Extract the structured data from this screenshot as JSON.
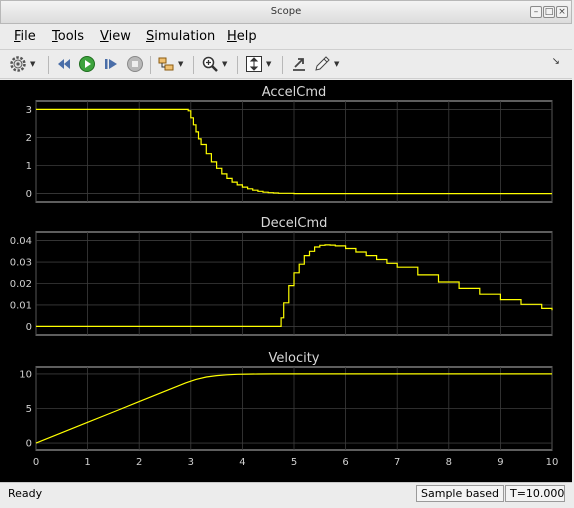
{
  "window": {
    "title": "Scope"
  },
  "menu": [
    {
      "label": "File",
      "key": "F"
    },
    {
      "label": "Tools",
      "key": "T"
    },
    {
      "label": "View",
      "key": "V"
    },
    {
      "label": "Simulation",
      "key": "S"
    },
    {
      "label": "Help",
      "key": "H"
    }
  ],
  "toolbar": {
    "buttons": [
      "settings-icon",
      "rewind-icon",
      "run-icon",
      "step-forward-icon",
      "stop-icon",
      "highlight-block-icon",
      "zoom-in-icon",
      "autoscale-icon",
      "restore-icon",
      "style-icon"
    ]
  },
  "status": {
    "left": "Ready",
    "mode": "Sample based",
    "time": "T=10.000"
  },
  "chart_data": [
    {
      "type": "line",
      "title": "AccelCmd",
      "xlim": [
        0,
        10
      ],
      "ylim": [
        -0.3,
        3.3
      ],
      "yticks": [
        "0",
        "1",
        "2",
        "3"
      ],
      "series": [
        {
          "color": "#ffff00",
          "x": [
            0,
            2.9,
            2.95,
            3.0,
            3.05,
            3.1,
            3.15,
            3.2,
            3.3,
            3.4,
            3.5,
            3.6,
            3.7,
            3.8,
            3.9,
            4.0,
            4.1,
            4.2,
            4.3,
            4.4,
            4.5,
            4.6,
            4.7,
            5.0,
            10
          ],
          "y": [
            3,
            3,
            2.95,
            2.7,
            2.45,
            2.2,
            1.95,
            1.75,
            1.42,
            1.13,
            0.9,
            0.7,
            0.54,
            0.41,
            0.31,
            0.23,
            0.17,
            0.12,
            0.08,
            0.05,
            0.03,
            0.02,
            0.01,
            0,
            0
          ]
        }
      ]
    },
    {
      "type": "line",
      "title": "DecelCmd",
      "xlim": [
        0,
        10
      ],
      "ylim": [
        -0.004,
        0.044
      ],
      "yticks": [
        "0",
        "0.01",
        "0.02",
        "0.03",
        "0.04"
      ],
      "series": [
        {
          "color": "#ffff00",
          "x": [
            0,
            4.7,
            4.75,
            4.8,
            4.9,
            5.0,
            5.1,
            5.2,
            5.3,
            5.4,
            5.5,
            5.6,
            5.7,
            5.8,
            6.0,
            6.2,
            6.4,
            6.6,
            6.8,
            7.0,
            7.4,
            7.8,
            8.2,
            8.6,
            9.0,
            9.4,
            9.8,
            10
          ],
          "y": [
            0,
            0,
            0.004,
            0.011,
            0.019,
            0.025,
            0.029,
            0.033,
            0.035,
            0.037,
            0.0378,
            0.038,
            0.0379,
            0.0375,
            0.0363,
            0.0347,
            0.033,
            0.0312,
            0.0294,
            0.0276,
            0.024,
            0.0207,
            0.0177,
            0.015,
            0.0125,
            0.0103,
            0.0084,
            0.0075
          ]
        }
      ]
    },
    {
      "type": "line",
      "title": "Velocity",
      "xlim": [
        0,
        10
      ],
      "ylim": [
        -1,
        11
      ],
      "yticks": [
        "0",
        "5",
        "10"
      ],
      "xticks": [
        "0",
        "1",
        "2",
        "3",
        "4",
        "5",
        "6",
        "7",
        "8",
        "9",
        "10"
      ],
      "series": [
        {
          "color": "#ffff00",
          "x": [
            0,
            0.5,
            1,
            1.5,
            2,
            2.5,
            2.9,
            3.1,
            3.3,
            3.5,
            3.7,
            3.9,
            4.1,
            4.3,
            4.6,
            5,
            10
          ],
          "y": [
            0,
            1.5,
            3,
            4.5,
            6,
            7.5,
            8.7,
            9.2,
            9.55,
            9.75,
            9.87,
            9.94,
            9.97,
            9.99,
            10,
            10,
            10
          ]
        }
      ]
    }
  ]
}
